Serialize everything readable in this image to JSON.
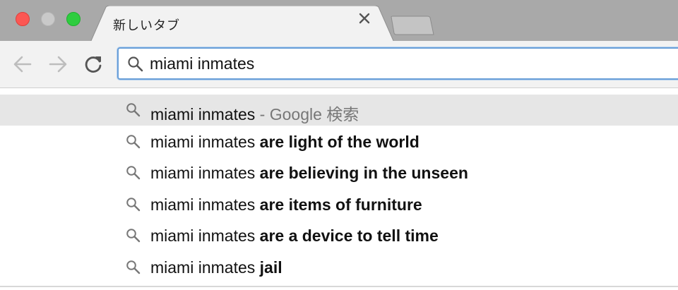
{
  "tab": {
    "title": "新しいタブ",
    "close_icon": "close-icon"
  },
  "toolbar": {
    "back_icon": "back-arrow-icon",
    "forward_icon": "forward-arrow-icon",
    "reload_icon": "reload-icon"
  },
  "omnibox": {
    "value": "miami inmates"
  },
  "suggestions": [
    {
      "query": "miami inmates",
      "completion": "",
      "sep": " - ",
      "provider": "Google 検索"
    },
    {
      "query": "miami inmates ",
      "completion": "are light of the world"
    },
    {
      "query": "miami inmates ",
      "completion": "are believing in the unseen"
    },
    {
      "query": "miami inmates ",
      "completion": "are items of furniture"
    },
    {
      "query": "miami inmates ",
      "completion": "are a device to tell time"
    },
    {
      "query": "miami inmates ",
      "completion": "jail"
    }
  ],
  "colors": {
    "close": "#fc5753",
    "minimize": "#c9c9c9",
    "maximize": "#2ecd3f",
    "focus_ring": "#6a9fd8",
    "selected_row": "#e6e6e6"
  }
}
